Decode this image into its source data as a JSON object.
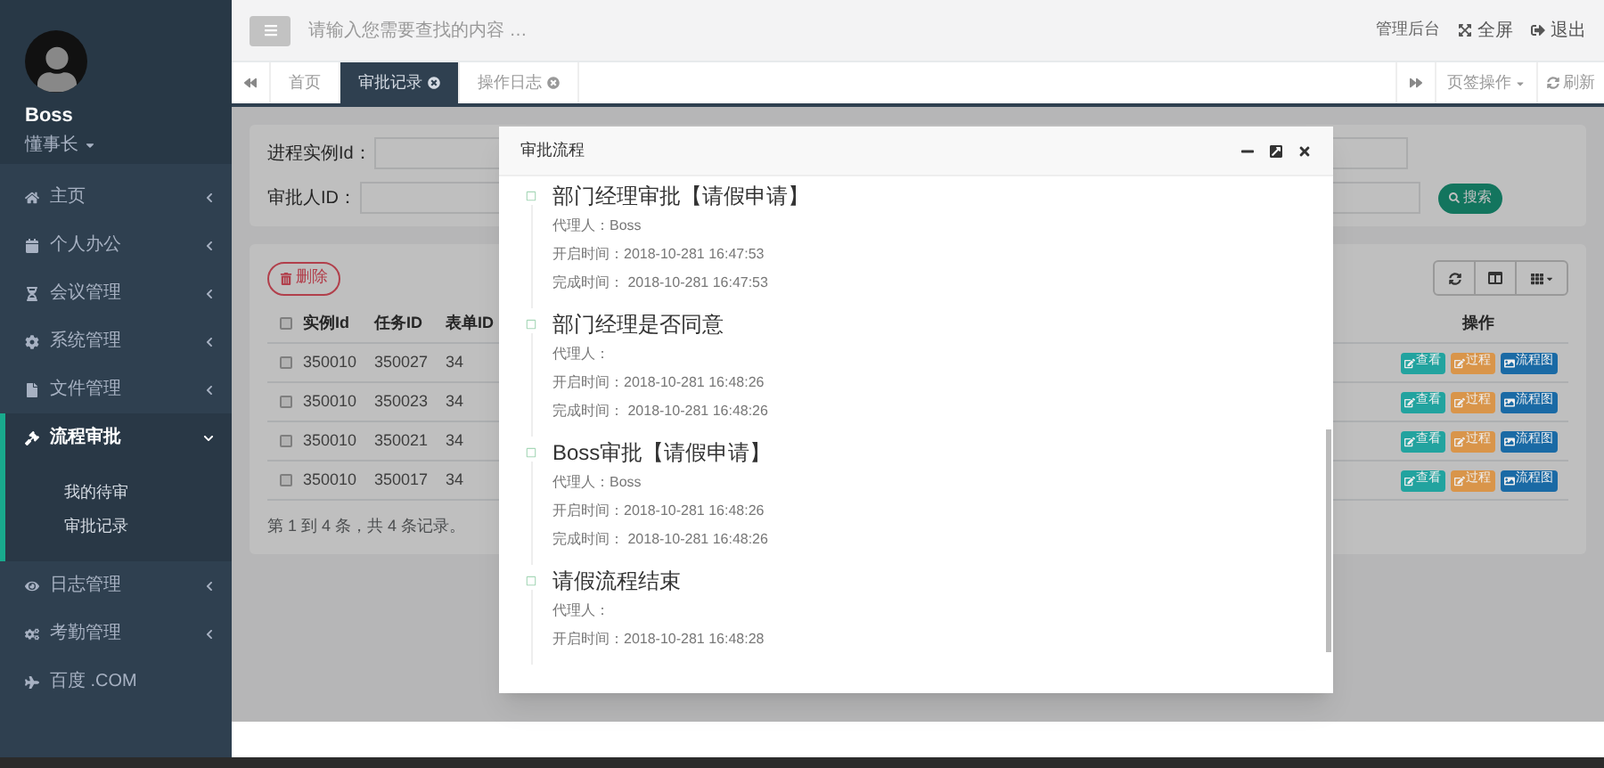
{
  "sidebar": {
    "user": {
      "name": "Boss",
      "role": "懂事长"
    },
    "items": [
      {
        "label": "主页",
        "kind": "menu",
        "expanded": false
      },
      {
        "label": "个人办公",
        "kind": "menu",
        "expanded": false
      },
      {
        "label": "会议管理",
        "kind": "menu",
        "expanded": false
      },
      {
        "label": "系统管理",
        "kind": "menu",
        "expanded": false
      },
      {
        "label": "文件管理",
        "kind": "menu",
        "expanded": false
      },
      {
        "label": "流程审批",
        "kind": "menu",
        "expanded": true,
        "children": [
          {
            "label": "我的待审",
            "selected": false
          },
          {
            "label": "审批记录",
            "selected": false
          }
        ]
      },
      {
        "label": "日志管理",
        "kind": "menu",
        "expanded": false
      },
      {
        "label": "考勤管理",
        "kind": "menu",
        "expanded": false
      },
      {
        "label": "百度 .COM",
        "kind": "link",
        "expanded": false
      }
    ]
  },
  "topbar": {
    "search": {
      "placeholder": "请输入您需要查找的内容 …"
    },
    "admin_link": "管理后台",
    "fullscreen": "全屏",
    "logout": "退出"
  },
  "tabs": [
    {
      "label": "首页",
      "selected": false,
      "closable": false
    },
    {
      "label": "审批记录",
      "selected": true,
      "closable": true
    },
    {
      "label": "操作日志",
      "selected": false,
      "closable": true
    }
  ],
  "tab_actions": {
    "menu": "页签操作",
    "refresh": "刷新"
  },
  "search_form": {
    "fields": [
      {
        "label": "进程实例Id："
      },
      {
        "label": "审批人ID："
      }
    ],
    "button": "搜索"
  },
  "toolbar": {
    "delete": "删除"
  },
  "table": {
    "header_checked": false,
    "columns": [
      "实例Id",
      "任务ID",
      "表单ID",
      "操作"
    ],
    "rows": [
      {
        "checked": false,
        "cells": [
          "350010",
          "350027",
          "34"
        ],
        "actions": [
          {
            "label": "查看",
            "color": "#22a39f"
          },
          {
            "label": "过程",
            "color": "#d9954a"
          },
          {
            "label": "流程图",
            "color": "#1a6aa5"
          }
        ]
      },
      {
        "checked": false,
        "cells": [
          "350010",
          "350023",
          "34"
        ],
        "actions": [
          {
            "label": "查看",
            "color": "#22a39f"
          },
          {
            "label": "过程",
            "color": "#d9954a"
          },
          {
            "label": "流程图",
            "color": "#1a6aa5"
          }
        ]
      },
      {
        "checked": false,
        "cells": [
          "350010",
          "350021",
          "34"
        ],
        "actions": [
          {
            "label": "查看",
            "color": "#22a39f"
          },
          {
            "label": "过程",
            "color": "#d9954a"
          },
          {
            "label": "流程图",
            "color": "#1a6aa5"
          }
        ]
      },
      {
        "checked": false,
        "cells": [
          "350010",
          "350017",
          "34"
        ],
        "actions": [
          {
            "label": "查看",
            "color": "#22a39f"
          },
          {
            "label": "过程",
            "color": "#d9954a"
          },
          {
            "label": "流程图",
            "color": "#1a6aa5"
          }
        ]
      }
    ]
  },
  "pagination_info": "第 1 到 4 条，共 4 条记录。",
  "modal": {
    "title": "审批流程",
    "steps": [
      {
        "title": "部门经理审批【请假申请】",
        "lines": [
          "代理人：Boss",
          "开启时间：2018-10-281 16:47:53",
          "完成时间： 2018-10-281 16:47:53"
        ]
      },
      {
        "title": "部门经理是否同意",
        "lines": [
          "代理人：",
          "开启时间：2018-10-281 16:48:26",
          "完成时间： 2018-10-281 16:48:26"
        ]
      },
      {
        "title": "Boss审批【请假申请】",
        "lines": [
          "代理人：Boss",
          "开启时间：2018-10-281 16:48:26",
          "完成时间： 2018-10-281 16:48:26"
        ]
      },
      {
        "title": "请假流程结束",
        "lines": [
          "代理人：",
          "开启时间：2018-10-281 16:48:28"
        ]
      }
    ]
  }
}
